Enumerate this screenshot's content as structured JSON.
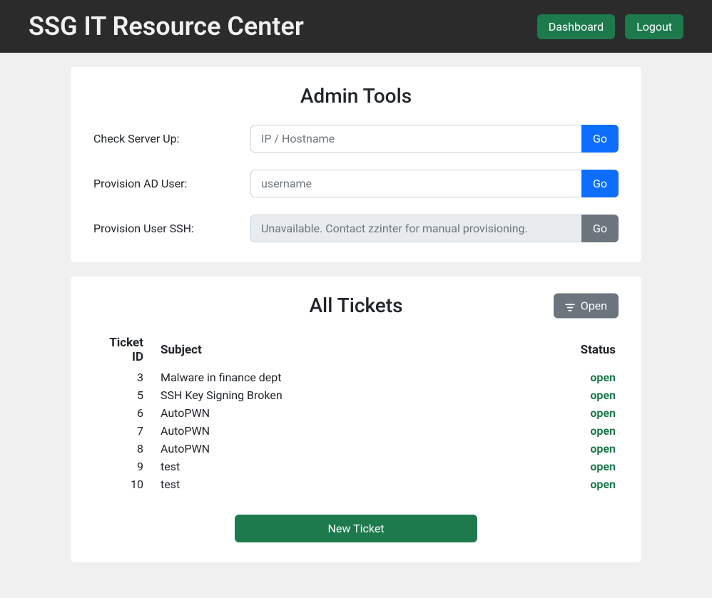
{
  "navbar": {
    "brand": "SSG IT Resource Center",
    "dashboard_label": "Dashboard",
    "logout_label": "Logout"
  },
  "admin_tools": {
    "title": "Admin Tools",
    "tools": [
      {
        "label": "Check Server Up:",
        "placeholder": "IP / Hostname",
        "button": "Go",
        "disabled": false
      },
      {
        "label": "Provision AD User:",
        "placeholder": "username",
        "button": "Go",
        "disabled": false
      },
      {
        "label": "Provision User SSH:",
        "placeholder": "Unavailable. Contact zzinter for manual provisioning.",
        "button": "Go",
        "disabled": true
      }
    ]
  },
  "tickets": {
    "title": "All Tickets",
    "filter_label": "Open",
    "columns": {
      "id": "Ticket ID",
      "subject": "Subject",
      "status": "Status"
    },
    "rows": [
      {
        "id": "3",
        "subject": "Malware in finance dept",
        "status": "open"
      },
      {
        "id": "5",
        "subject": "SSH Key Signing Broken",
        "status": "open"
      },
      {
        "id": "6",
        "subject": "AutoPWN",
        "status": "open"
      },
      {
        "id": "7",
        "subject": "AutoPWN",
        "status": "open"
      },
      {
        "id": "8",
        "subject": "AutoPWN",
        "status": "open"
      },
      {
        "id": "9",
        "subject": "test",
        "status": "open"
      },
      {
        "id": "10",
        "subject": "test",
        "status": "open"
      }
    ],
    "new_ticket_label": "New Ticket"
  },
  "colors": {
    "brand_green": "#1c7a4c",
    "primary_blue": "#0d6efd",
    "secondary_gray": "#6c757d"
  }
}
